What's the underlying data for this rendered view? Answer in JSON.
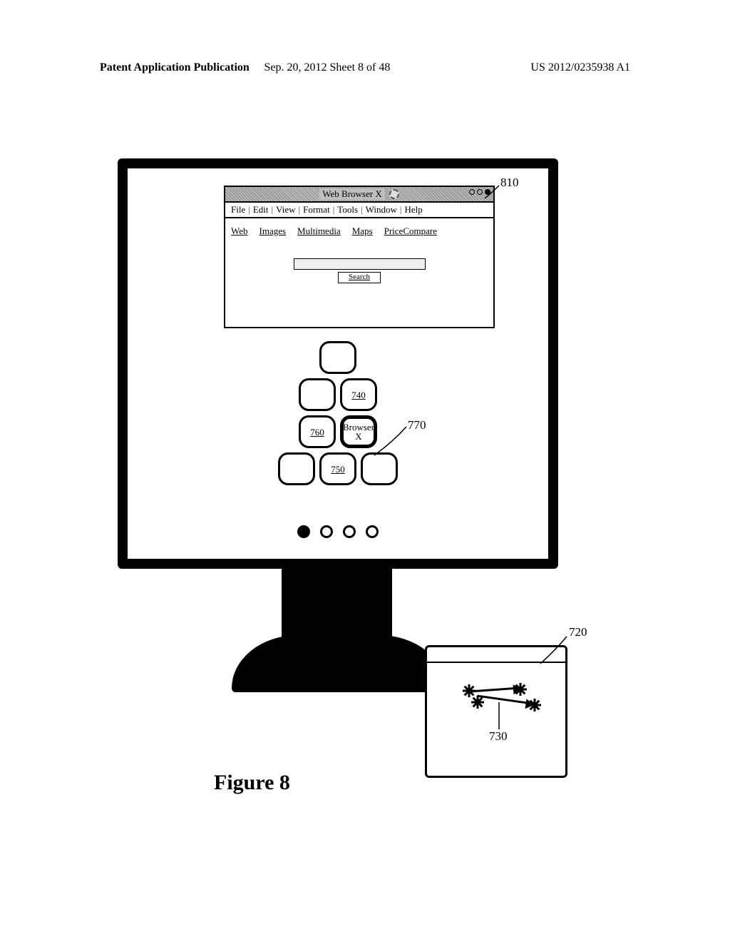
{
  "header": {
    "left": "Patent Application Publication",
    "center": "Sep. 20, 2012  Sheet 8 of 48",
    "right": "US 2012/0235938 A1"
  },
  "callouts": {
    "c810": "810",
    "c770": "770",
    "c720": "720",
    "c730": "730"
  },
  "browser": {
    "title": "Web Browser X",
    "menu": [
      "File",
      "Edit",
      "View",
      "Format",
      "Tools",
      "Window",
      "Help"
    ],
    "tabs": [
      "Web",
      "Images",
      "Multimedia",
      "Maps",
      "PriceCompare"
    ],
    "search_label": "Search"
  },
  "icons": {
    "row2": {
      "i1": "740"
    },
    "row3": {
      "i1": "760",
      "i2_line1": "Browser",
      "i2_line2": "X"
    },
    "row4": {
      "i2": "750"
    }
  },
  "page_indicator": {
    "total": 4,
    "active": 0
  },
  "figure_caption": "Figure 8"
}
